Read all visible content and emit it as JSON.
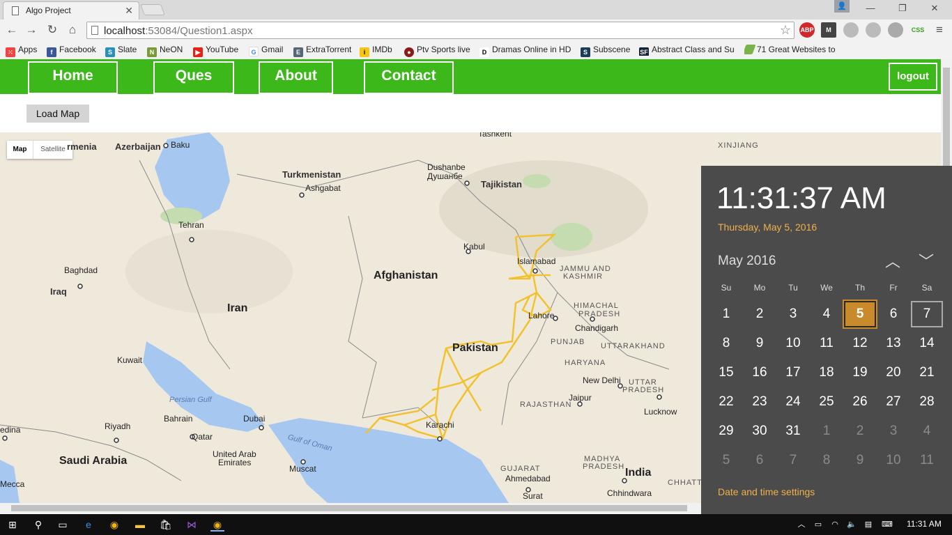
{
  "browser": {
    "tab_title": "Algo Project",
    "url_host": "localhost",
    "url_path": ":53084/Question1.aspx",
    "extensions": [
      "ABP",
      "M",
      "CSS"
    ]
  },
  "bookmarks": [
    {
      "label": "Apps"
    },
    {
      "label": "Facebook"
    },
    {
      "label": "Slate"
    },
    {
      "label": "NeON"
    },
    {
      "label": "YouTube"
    },
    {
      "label": "Gmail"
    },
    {
      "label": "ExtraTorrent"
    },
    {
      "label": "IMDb"
    },
    {
      "label": "Ptv Sports live"
    },
    {
      "label": "Dramas Online in HD"
    },
    {
      "label": "Subscene"
    },
    {
      "label": "Abstract Class and Su"
    },
    {
      "label": "71 Great Websites to"
    }
  ],
  "site": {
    "nav": [
      "Home",
      "Ques",
      "About",
      "Contact"
    ],
    "logout": "logout",
    "load_map": "Load Map",
    "accent": "#3cb81a"
  },
  "map": {
    "toggle_map": "Map",
    "toggle_satellite": "Satellite",
    "labels": {
      "azerbaijan": "Azerbaijan",
      "baku": "Baku",
      "armenia": "rmenia",
      "turkmenistan": "Turkmenistan",
      "ashgabat": "Ashgabat",
      "tashkent": "Tashkent",
      "dushanbe": "Dushanbe",
      "dushanbe_cyr": "Душанбе",
      "tajikistan": "Tajikistan",
      "xinjiang": "XINJIANG",
      "tehran": "Tehran",
      "kabul": "Kabul",
      "afghanistan": "Afghanistan",
      "baghdad": "Baghdad",
      "iraq": "Iraq",
      "iran": "Iran",
      "islamabad": "Islamabad",
      "jammu": "JAMMU AND",
      "kashmir": "KASHMIR",
      "himachal": "HIMACHAL",
      "pradesh": "PRADESH",
      "lahore": "Lahore",
      "chandigarh": "Chandigarh",
      "punjab": "PUNJAB",
      "uttarakhand": "UTTARAKHAND",
      "pakistan": "Pakistan",
      "kuwait": "Kuwait",
      "haryana": "HARYANA",
      "new_delhi": "New Delhi",
      "uttar_pradesh": "UTTAR",
      "uttar_pradesh2": "PRADESH",
      "persian_gulf": "Persian Gulf",
      "jaipur": "Jaipur",
      "rajasthan": "RAJASTHAN",
      "lucknow": "Lucknow",
      "bahrain": "Bahrain",
      "dubai": "Dubai",
      "riyadh": "Riyadh",
      "qatar": "Qatar",
      "gulf_of_oman": "Gulf of Oman",
      "karachi": "Karachi",
      "medina": "edina",
      "uae1": "United Arab",
      "uae2": "Emirates",
      "muscat": "Muscat",
      "saudi": "Saudi Arabia",
      "gujarat": "GUJARAT",
      "ahmedabad": "Ahmedabad",
      "madhya": "MADHYA",
      "madhya2": "PRADESH",
      "india": "India",
      "mecca": "Mecca",
      "surat": "Surat",
      "chhindwara": "Chhindwara",
      "chhattisga": "CHHATTISGA"
    },
    "route_color": "#f2c12e"
  },
  "clock_flyout": {
    "time": "11:31:37 AM",
    "date": "Thursday, May 5, 2016",
    "month": "May 2016",
    "weekdays": [
      "Su",
      "Mo",
      "Tu",
      "We",
      "Th",
      "Fr",
      "Sa"
    ],
    "days": [
      [
        "1",
        "2",
        "3",
        "4",
        "5",
        "6",
        "7"
      ],
      [
        "8",
        "9",
        "10",
        "11",
        "12",
        "13",
        "14"
      ],
      [
        "15",
        "16",
        "17",
        "18",
        "19",
        "20",
        "21"
      ],
      [
        "22",
        "23",
        "24",
        "25",
        "26",
        "27",
        "28"
      ],
      [
        "29",
        "30",
        "31",
        "1",
        "2",
        "3",
        "4"
      ],
      [
        "5",
        "6",
        "7",
        "8",
        "9",
        "10",
        "11"
      ]
    ],
    "today": "5",
    "settings_link": "Date and time settings",
    "accent": "#c98a2b"
  },
  "taskbar": {
    "time": "11:31 AM"
  }
}
